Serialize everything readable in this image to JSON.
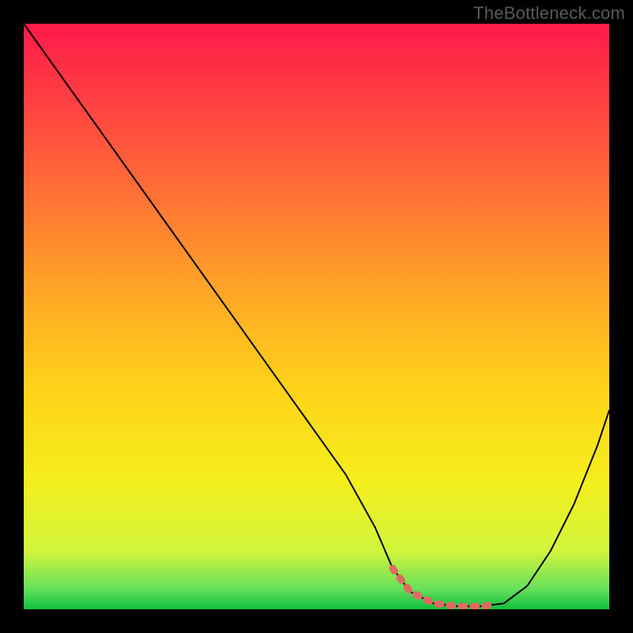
{
  "watermark": "TheBottleneck.com",
  "chart_data": {
    "type": "line",
    "title": "",
    "xlabel": "",
    "ylabel": "",
    "xlim": [
      0,
      100
    ],
    "ylim": [
      0,
      100
    ],
    "x": [
      0,
      5,
      10,
      15,
      20,
      25,
      30,
      35,
      40,
      45,
      50,
      55,
      60,
      63,
      66,
      70,
      74,
      78,
      82,
      86,
      90,
      94,
      98,
      100
    ],
    "series": [
      {
        "name": "bottleneck_curve",
        "values": [
          100,
          93,
          86,
          79,
          72,
          65,
          58,
          51,
          44,
          37,
          30,
          23,
          14,
          7,
          3,
          1,
          0.5,
          0.5,
          1,
          4,
          10,
          18,
          28,
          34
        ],
        "color": "#000000",
        "stroke_width": 2
      }
    ],
    "highlight_region": {
      "x_start": 63,
      "x_end": 80,
      "color": "#e06a62"
    },
    "background_gradient": {
      "stops": [
        {
          "offset": 0.0,
          "color": "#ff1a4a"
        },
        {
          "offset": 0.22,
          "color": "#ff5a3c"
        },
        {
          "offset": 0.45,
          "color": "#ffa427"
        },
        {
          "offset": 0.62,
          "color": "#ffd21a"
        },
        {
          "offset": 0.78,
          "color": "#f5ee1c"
        },
        {
          "offset": 0.9,
          "color": "#d2f53c"
        },
        {
          "offset": 0.965,
          "color": "#66e05a"
        },
        {
          "offset": 1.0,
          "color": "#10c040"
        }
      ]
    }
  }
}
